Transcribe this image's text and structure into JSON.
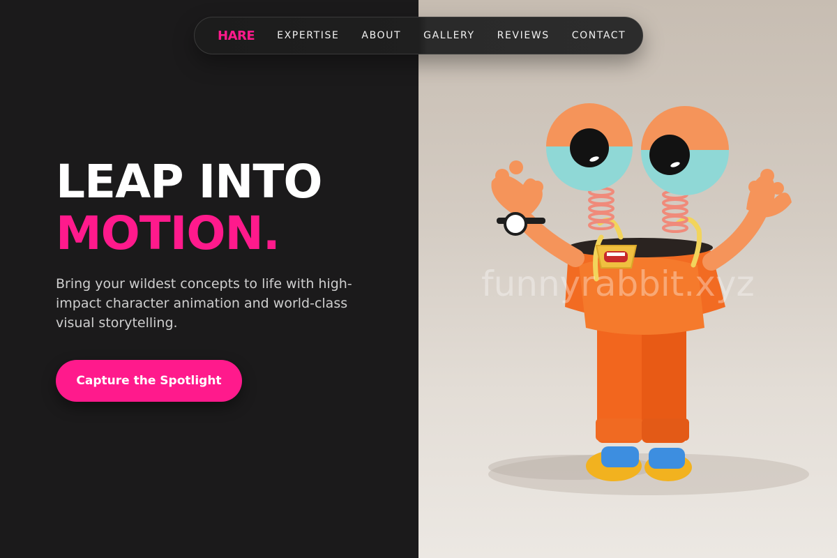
{
  "nav": {
    "logo": "HARE",
    "links": [
      "EXPERTISE",
      "ABOUT",
      "GALLERY",
      "REVIEWS",
      "CONTACT"
    ]
  },
  "hero": {
    "headline_line1": "LEAP INTO",
    "headline_line2": "MOTION.",
    "subtext": "Bring your wildest concepts to life with high-impact character animation and world-class visual storytelling.",
    "cta_label": "Capture the Spotlight"
  },
  "media": {
    "watermark": "funnyrabbit.xyz"
  },
  "colors": {
    "accent": "#ff1a8c",
    "dark_background": "#1b1a1b",
    "light_background": "#d4ccc3"
  }
}
